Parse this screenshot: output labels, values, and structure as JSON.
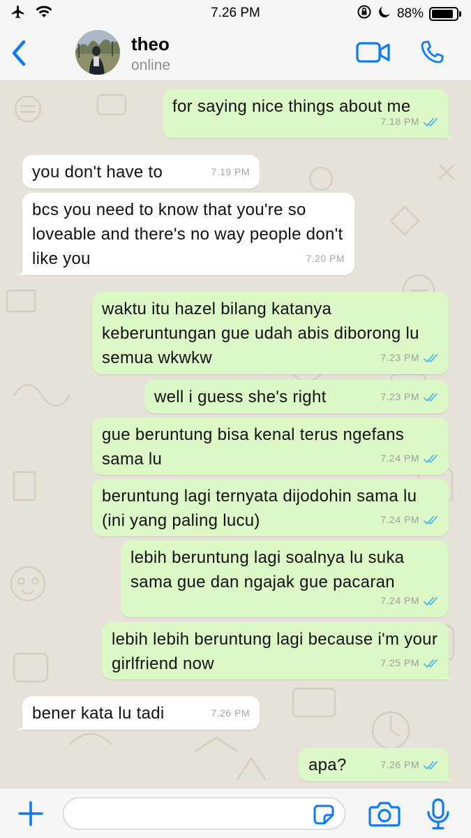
{
  "status_bar": {
    "time": "7.26 PM",
    "battery": "88%",
    "battery_level": 0.88,
    "icons": [
      "airplane-icon",
      "wifi-icon",
      "orientation-lock-icon",
      "moon-icon",
      "battery-icon"
    ]
  },
  "header": {
    "contact_name": "theo",
    "contact_status": "online",
    "accent_color": "#0a7aff"
  },
  "messages": [
    {
      "dir": "out",
      "text": "for saying nice things about me",
      "time": "7.18 PM",
      "read": true
    },
    {
      "dir": "in",
      "text": "you don't have to",
      "time": "7.19 PM"
    },
    {
      "dir": "in",
      "text": "bcs you need to know that you're so loveable and there's no way people don't like you",
      "time": "7.20 PM"
    },
    {
      "dir": "out",
      "text": "waktu itu hazel bilang katanya keberuntungan gue udah abis diborong lu semua wkwkw",
      "time": "7.23 PM",
      "read": true
    },
    {
      "dir": "out",
      "text": "well i guess she's right",
      "time": "7.23 PM",
      "read": true
    },
    {
      "dir": "out",
      "text": "gue beruntung bisa kenal terus ngefans sama lu",
      "time": "7.24 PM",
      "read": true
    },
    {
      "dir": "out",
      "text": "beruntung lagi ternyata dijodohin sama lu (ini yang paling lucu)",
      "time": "7.24 PM",
      "read": true
    },
    {
      "dir": "out",
      "text": "lebih beruntung lagi soalnya lu suka sama gue dan ngajak gue pacaran",
      "time": "7.24 PM",
      "read": true
    },
    {
      "dir": "out",
      "text": "lebih lebih beruntung lagi because i'm your girlfriend now",
      "time": "7.25 PM",
      "read": true
    },
    {
      "dir": "in",
      "text": "bener kata lu tadi",
      "time": "7.26 PM"
    },
    {
      "dir": "out",
      "text": "apa?",
      "time": "7.26 PM",
      "read": true
    }
  ],
  "colors": {
    "outgoing_bubble": "#dcf8c6",
    "incoming_bubble": "#ffffff",
    "read_ticks": "#4fb6ec",
    "chat_background": "#e7e2d9"
  },
  "input_bar": {
    "placeholder": "",
    "value": ""
  }
}
